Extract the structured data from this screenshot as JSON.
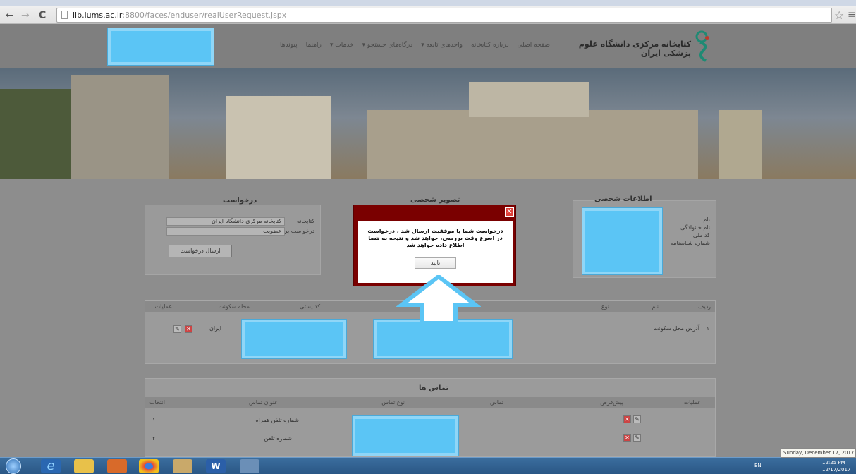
{
  "browser": {
    "url_host": "lib.iums.ac.ir",
    "url_rest": ":8800/faces/enduser/realUserRequest.jspx",
    "back_glyph": "←",
    "forward_glyph": "→",
    "reload_glyph": "C",
    "star_icon": "☆",
    "menu_icon": "≡"
  },
  "header": {
    "site_title": "کتابخانه مرکزی دانشگاه علوم پزشکی ایران",
    "nav": [
      "صفحه اصلی",
      "درباره کتابخانه",
      "واحدهای تابعه ▾",
      "درگاه‌های جستجو ▾",
      "خدمات ▾",
      "راهنما",
      "پیوندها"
    ]
  },
  "personal_info": {
    "title": "اطلاعات شخصی",
    "labels": [
      "نام",
      "نام خانوادگی",
      "کد ملی",
      "شماره شناسنامه"
    ]
  },
  "personal_image": {
    "title": "تصویر شخصی"
  },
  "request": {
    "title": "درخواست",
    "library_label": "کتابخانه",
    "library_value": "کتابخانه مرکزی دانشگاه ایران",
    "request_for_label": "درخواست برای",
    "request_for_value": "عضویت",
    "send_button": "ارسال درخواست"
  },
  "addresses": {
    "headers": [
      "ردیف",
      "نام",
      "نوع",
      "کد پستی",
      "محله سکونت",
      "عملیات"
    ],
    "rows": [
      {
        "index": "۱",
        "name": "آدرس محل سکونت",
        "city": "ایران"
      }
    ]
  },
  "contacts": {
    "title": "تماس ها",
    "headers": [
      "عملیات",
      "پیش‌فرض",
      "تماس",
      "نوع تماس",
      "عنوان تماس",
      "انتخاب"
    ],
    "rows": [
      {
        "title": "شماره تلفن همراه",
        "index": "۱"
      },
      {
        "title": "شماره تلفن",
        "index": "۲"
      }
    ]
  },
  "dialog": {
    "message": "درخواست شما با موفقیت ارسال شد ، درخواست در اسرع وقت بررسی، خواهد شد و نتیجه به شما اطلاع داده خواهد شد",
    "ok_label": "تایید",
    "close_glyph": "✕"
  },
  "taskbar": {
    "language": "EN",
    "time": "12:25 PM",
    "date": "12/17/2017",
    "tooltip": "Sunday, December 17, 2017",
    "word_glyph": "W",
    "ie_glyph": "e"
  }
}
